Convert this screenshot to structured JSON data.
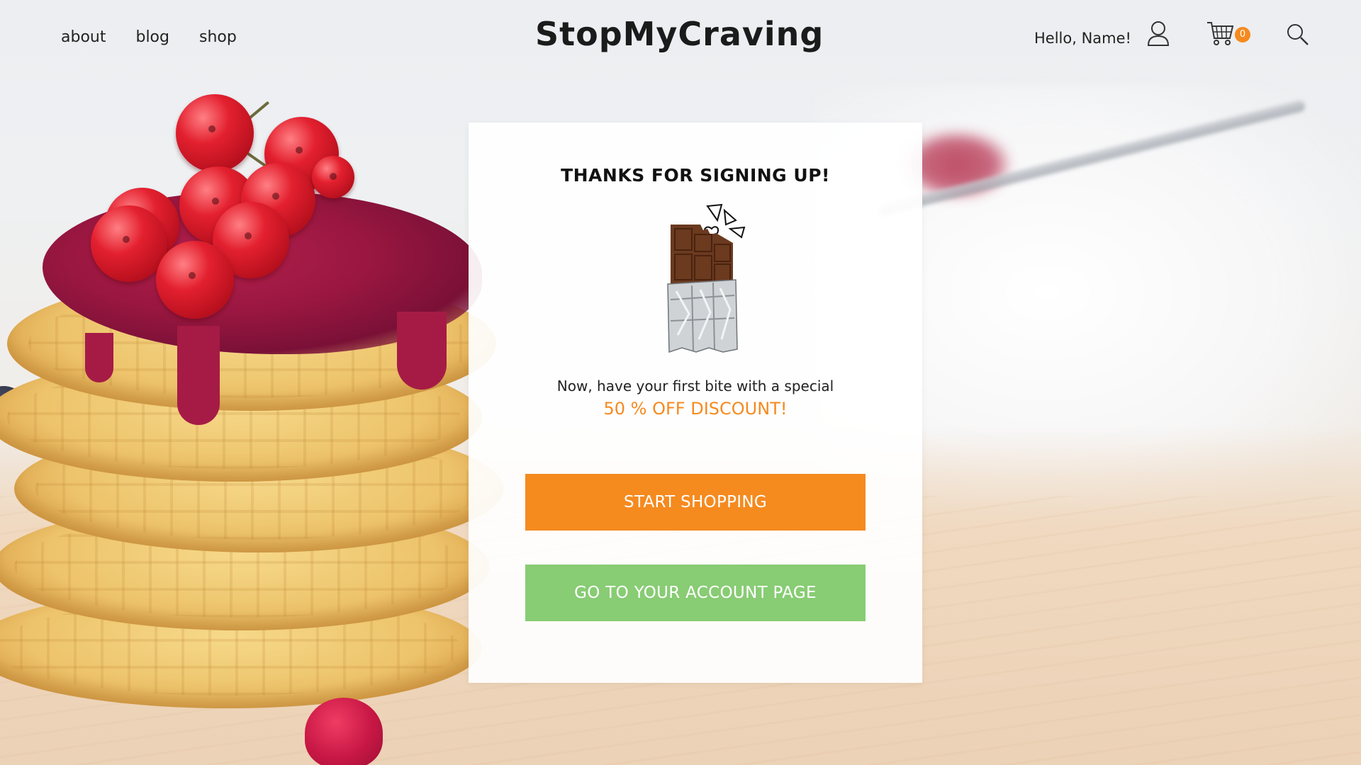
{
  "header": {
    "nav": [
      {
        "id": "about",
        "label": "about"
      },
      {
        "id": "blog",
        "label": "blog"
      },
      {
        "id": "shop",
        "label": "shop"
      }
    ],
    "logo": "StopMyCraving",
    "greeting": "Hello, Name!",
    "cart_count": "0",
    "icons": {
      "user": "user-icon",
      "cart": "cart-icon",
      "search": "search-icon"
    }
  },
  "modal": {
    "title": "THANKS FOR SIGNING UP!",
    "message": "Now, have your first bite with a special",
    "discount": "50 % OFF DISCOUNT!",
    "primary_button": "START SHOPPING",
    "secondary_button": "GO TO YOUR ACCOUNT PAGE",
    "illustration": "chocolate-bar-icon"
  },
  "colors": {
    "accent_orange": "#f58a1f",
    "accent_green": "#88cc74",
    "text_dark": "#222222"
  }
}
